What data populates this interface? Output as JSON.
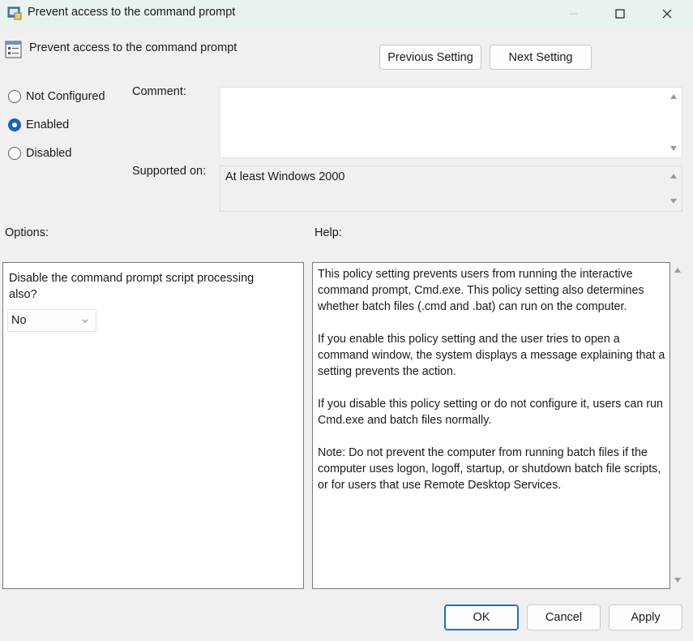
{
  "window": {
    "title": "Prevent access to the command prompt"
  },
  "header": {
    "policy_title": "Prevent access to the command prompt",
    "previous_label": "Previous Setting",
    "next_label": "Next Setting"
  },
  "state": {
    "options": [
      {
        "label": "Not Configured",
        "selected": false
      },
      {
        "label": "Enabled",
        "selected": true
      },
      {
        "label": "Disabled",
        "selected": false
      }
    ]
  },
  "comment": {
    "label": "Comment:",
    "value": ""
  },
  "supported": {
    "label": "Supported on:",
    "value": "At least Windows 2000"
  },
  "options_panel": {
    "label": "Options:",
    "question": "Disable the command prompt script processing also?",
    "select_value": "No"
  },
  "help_panel": {
    "label": "Help:",
    "paragraphs": [
      "This policy setting prevents users from running the interactive command prompt, Cmd.exe.  This policy setting also determines whether batch files (.cmd and .bat) can run on the computer.",
      "If you enable this policy setting and the user tries to open a command window, the system displays a message explaining that a setting prevents the action.",
      "If you disable this policy setting or do not configure it, users can run Cmd.exe and batch files normally.",
      "Note: Do not prevent the computer from running batch files if the computer uses logon, logoff, startup, or shutdown batch file scripts, or for users that use Remote Desktop Services."
    ]
  },
  "footer": {
    "ok_label": "OK",
    "cancel_label": "Cancel",
    "apply_label": "Apply"
  },
  "colors": {
    "titlebar": "#e7f3ec",
    "accent": "#1d62b8",
    "ok_border": "#1d6fc7"
  }
}
